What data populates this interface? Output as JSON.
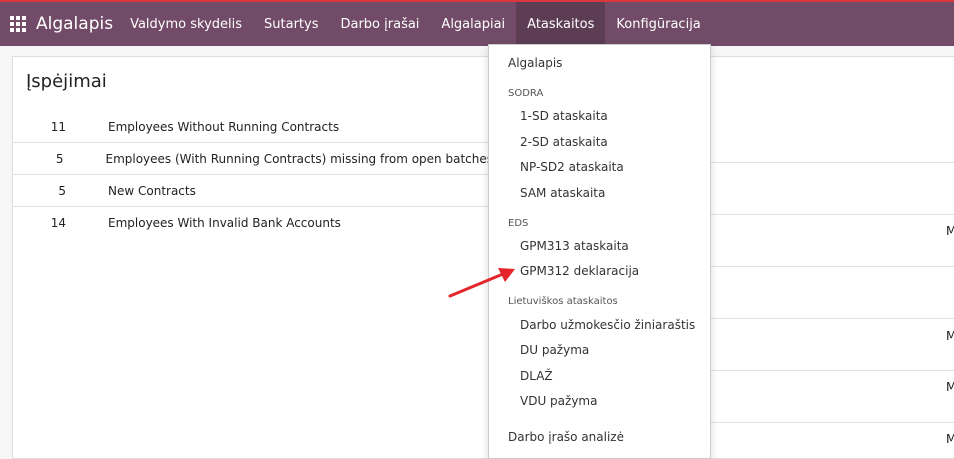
{
  "app": {
    "title": "Algalapis"
  },
  "nav": {
    "items": [
      {
        "label": "Valdymo skydelis"
      },
      {
        "label": "Sutartys"
      },
      {
        "label": "Darbo įrašai"
      },
      {
        "label": "Algalapiai"
      },
      {
        "label": "Ataskaitos"
      },
      {
        "label": "Konfigūracija"
      }
    ]
  },
  "warnings": {
    "title": "Įspėjimai",
    "rows": [
      {
        "count": "11",
        "label": "Employees Without Running Contracts"
      },
      {
        "count": "5",
        "label": "Employees (With Running Contracts) missing from open batches"
      },
      {
        "count": "5",
        "label": "New Contracts"
      },
      {
        "count": "14",
        "label": "Employees With Invalid Bank Accounts"
      }
    ]
  },
  "right_edge": {
    "text": "M"
  },
  "menu": {
    "top_item": "Algalapis",
    "sodra": {
      "heading": "SODRA",
      "items": [
        "1-SD ataskaita",
        "2-SD ataskaita",
        "NP-SD2 ataskaita",
        "SAM ataskaita"
      ]
    },
    "eds": {
      "heading": "EDS",
      "items": [
        "GPM313 ataskaita",
        "GPM312 deklaracija"
      ]
    },
    "lt": {
      "heading": "Lietuviškos ataskaitos",
      "items": [
        "Darbo užmokesčio žiniaraštis",
        "DU pažyma",
        "DLAŽ",
        "VDU pažyma"
      ]
    },
    "bottom_item": "Darbo įrašo analizė"
  },
  "colors": {
    "topbar": "#714b67",
    "arrow": "#e4252b"
  }
}
